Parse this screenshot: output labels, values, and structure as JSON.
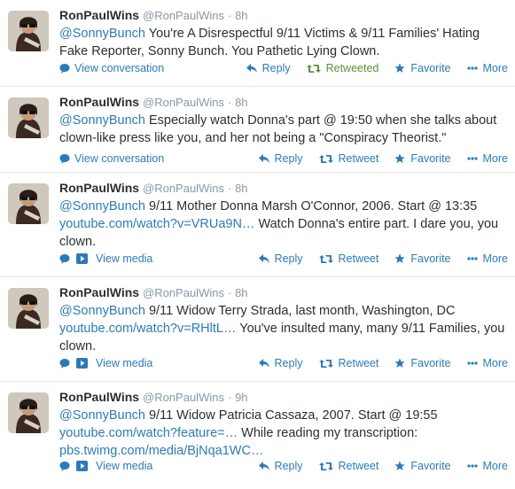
{
  "user": {
    "fullname": "RonPaulWins",
    "screen_name": "@RonPaulWins"
  },
  "separator": "·",
  "colors": {
    "link": "#2b7bb9",
    "retweeted": "#5c913b",
    "muted": "#8899a6"
  },
  "tweets": [
    {
      "time": "8h",
      "parts": [
        "@SonnyBunch You're A Disrespectful 9/11 Victims & 9/11 Families' Hating Fake Reporter, Sonny Bunch. You Pathetic Lying Clown."
      ],
      "secondary": "View conversation",
      "reply": "Reply",
      "retweet": "Retweeted",
      "favorite": "Favorite",
      "more": "More"
    },
    {
      "time": "8h",
      "mention": "@SonnyBunch",
      "body": "Especially watch Donna's part @ 19:50 when she talks about clown-like press like you, and her not being a \"Conspiracy Theorist.\"",
      "secondary": "View conversation",
      "reply": "Reply",
      "retweet": "Retweet",
      "favorite": "Favorite",
      "more": "More"
    },
    {
      "time": "8h",
      "mention": "@SonnyBunch",
      "body_a": "9/11 Mother Donna Marsh O'Connor, 2006. Start @ 13:35",
      "link": "youtube.com/watch?v=VRUa9N…",
      "body_b": "Watch Donna's entire part. I dare you, you clown.",
      "secondary": "View media",
      "reply": "Reply",
      "retweet": "Retweet",
      "favorite": "Favorite",
      "more": "More"
    },
    {
      "time": "8h",
      "mention": "@SonnyBunch",
      "body_a": "9/11 Widow Terry Strada, last month, Washington, DC",
      "link": "youtube.com/watch?v=RHltL…",
      "body_b": "You've insulted many, many 9/11 Families, you clown.",
      "secondary": "View media",
      "reply": "Reply",
      "retweet": "Retweet",
      "favorite": "Favorite",
      "more": "More"
    },
    {
      "time": "9h",
      "mention": "@SonnyBunch",
      "body_a": "9/11 Widow Patricia Cassaza, 2007. Start @ 19:55",
      "link": "youtube.com/watch?feature=…",
      "body_b": "While reading my transcription:",
      "link2": "pbs.twimg.com/media/BjNqa1WC…",
      "secondary": "View media",
      "reply": "Reply",
      "retweet": "Retweet",
      "favorite": "Favorite",
      "more": "More"
    }
  ]
}
